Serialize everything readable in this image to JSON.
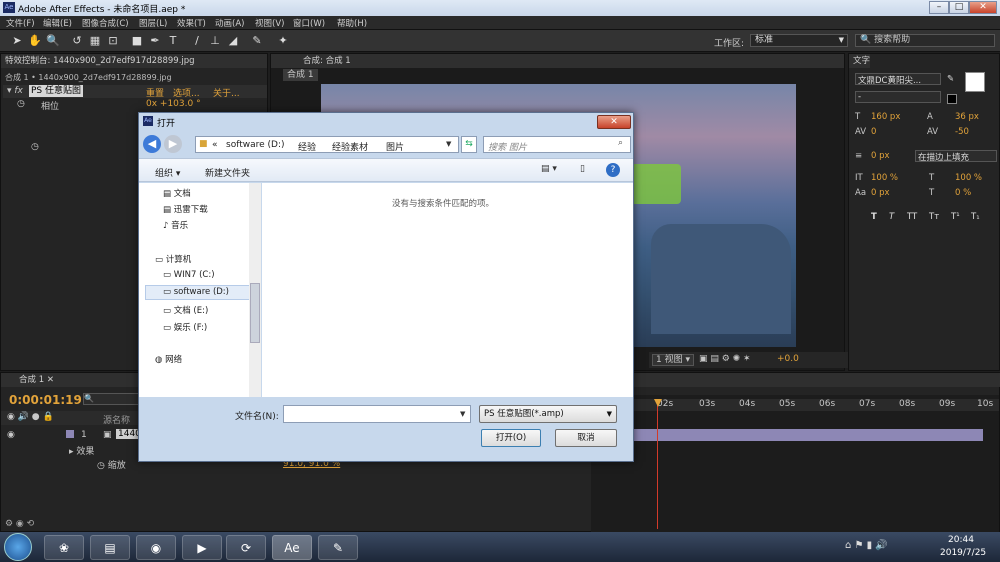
{
  "app": {
    "title": "Adobe After Effects - 未命名项目.aep *"
  },
  "menu": [
    "文件(F)",
    "编辑(E)",
    "图像合成(C)",
    "图层(L)",
    "效果(T)",
    "动画(A)",
    "视图(V)",
    "窗口(W)",
    "帮助(H)"
  ],
  "toolbar": {
    "workspace_label": "工作区:",
    "workspace_value": "标准",
    "search_help": "搜索帮助"
  },
  "effects_panel": {
    "tab": "特效控制台: 1440x900_2d7edf917d28899.jpg",
    "breadcrumb": "合成 1 • 1440x900_2d7edf917d28899.jpg",
    "effect_name": "PS 任意贴图",
    "links": [
      "重置",
      "选项...",
      "关于..."
    ],
    "prop_label": "相位",
    "prop_value": "0x +103.0 °"
  },
  "comp_panel": {
    "tab": "合成: 合成 1",
    "subtab": "合成 1",
    "view_select": "1 视图",
    "offset": "+0.0"
  },
  "text_panel": {
    "tab": "文字",
    "font": "文鼎DC黄阳尖...",
    "font_style": "-",
    "size": "160 px",
    "leading": "36 px",
    "kerning": "0",
    "tracking": "-50",
    "stroke_width": "0 px",
    "stroke_type": "在描边上填充",
    "v_scale": "100 %",
    "h_scale": "100 %",
    "baseline": "0 px",
    "tsume": "0 %",
    "styles": [
      "T",
      "T",
      "TT",
      "Tт",
      "T¹",
      "T₁"
    ]
  },
  "timeline": {
    "tab": "合成 1",
    "timecode": "0:00:01:19",
    "col_source": "源名称",
    "layer_num": "1",
    "layer_name": "1440",
    "effects_row": "效果",
    "scale_row": "缩放",
    "scale_value": "91.0, 91.0 %",
    "ruler": [
      "02s",
      "03s",
      "04s",
      "05s",
      "06s",
      "07s",
      "08s",
      "09s",
      "10s"
    ]
  },
  "dialog": {
    "title": "打开",
    "path": [
      "«",
      "software (D:)",
      "经验",
      "经验素材",
      "图片"
    ],
    "search_placeholder": "搜索 图片",
    "organize": "组织 ▾",
    "new_folder": "新建文件夹",
    "empty_msg": "没有与搜索条件匹配的项。",
    "sidebar": [
      "文档",
      "迅雷下载",
      "音乐",
      "计算机",
      "WIN7 (C:)",
      "software (D:)",
      "文档 (E:)",
      "娱乐 (F:)",
      "网络"
    ],
    "filename_label": "文件名(N):",
    "filename_value": "",
    "filetype": "PS 任意贴图(*.amp)",
    "open": "打开(O)",
    "cancel": "取消"
  },
  "taskbar": {
    "time": "20:44",
    "date": "2019/7/25"
  },
  "colors": {
    "accent_orange": "#e2a33a",
    "timecode": "#e2a33a",
    "playhead": "#d23a2a",
    "layer_bar": "#8d87b5"
  }
}
